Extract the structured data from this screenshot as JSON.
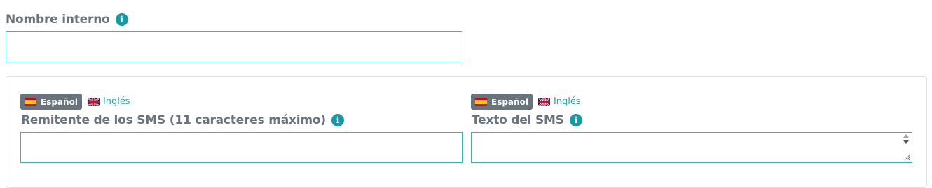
{
  "internal_name": {
    "label": "Nombre interno",
    "info_icon": "info-icon",
    "value": ""
  },
  "sender": {
    "languages": [
      {
        "label": "Español",
        "flag": "flag-es-icon",
        "active": true
      },
      {
        "label": "Inglés",
        "flag": "flag-uk-icon",
        "active": false
      }
    ],
    "label": "Remitente de los SMS (11 caracteres máximo)",
    "info_icon": "info-icon",
    "value": ""
  },
  "sms_text": {
    "languages": [
      {
        "label": "Español",
        "flag": "flag-es-icon",
        "active": true
      },
      {
        "label": "Inglés",
        "flag": "flag-uk-icon",
        "active": false
      }
    ],
    "label": "Texto del SMS",
    "info_icon": "info-icon",
    "value": ""
  },
  "colors": {
    "accent": "#1b98a6",
    "input_border": "#3bb2b0",
    "badge_bg": "#6a737b",
    "label_text": "#6a737b"
  }
}
